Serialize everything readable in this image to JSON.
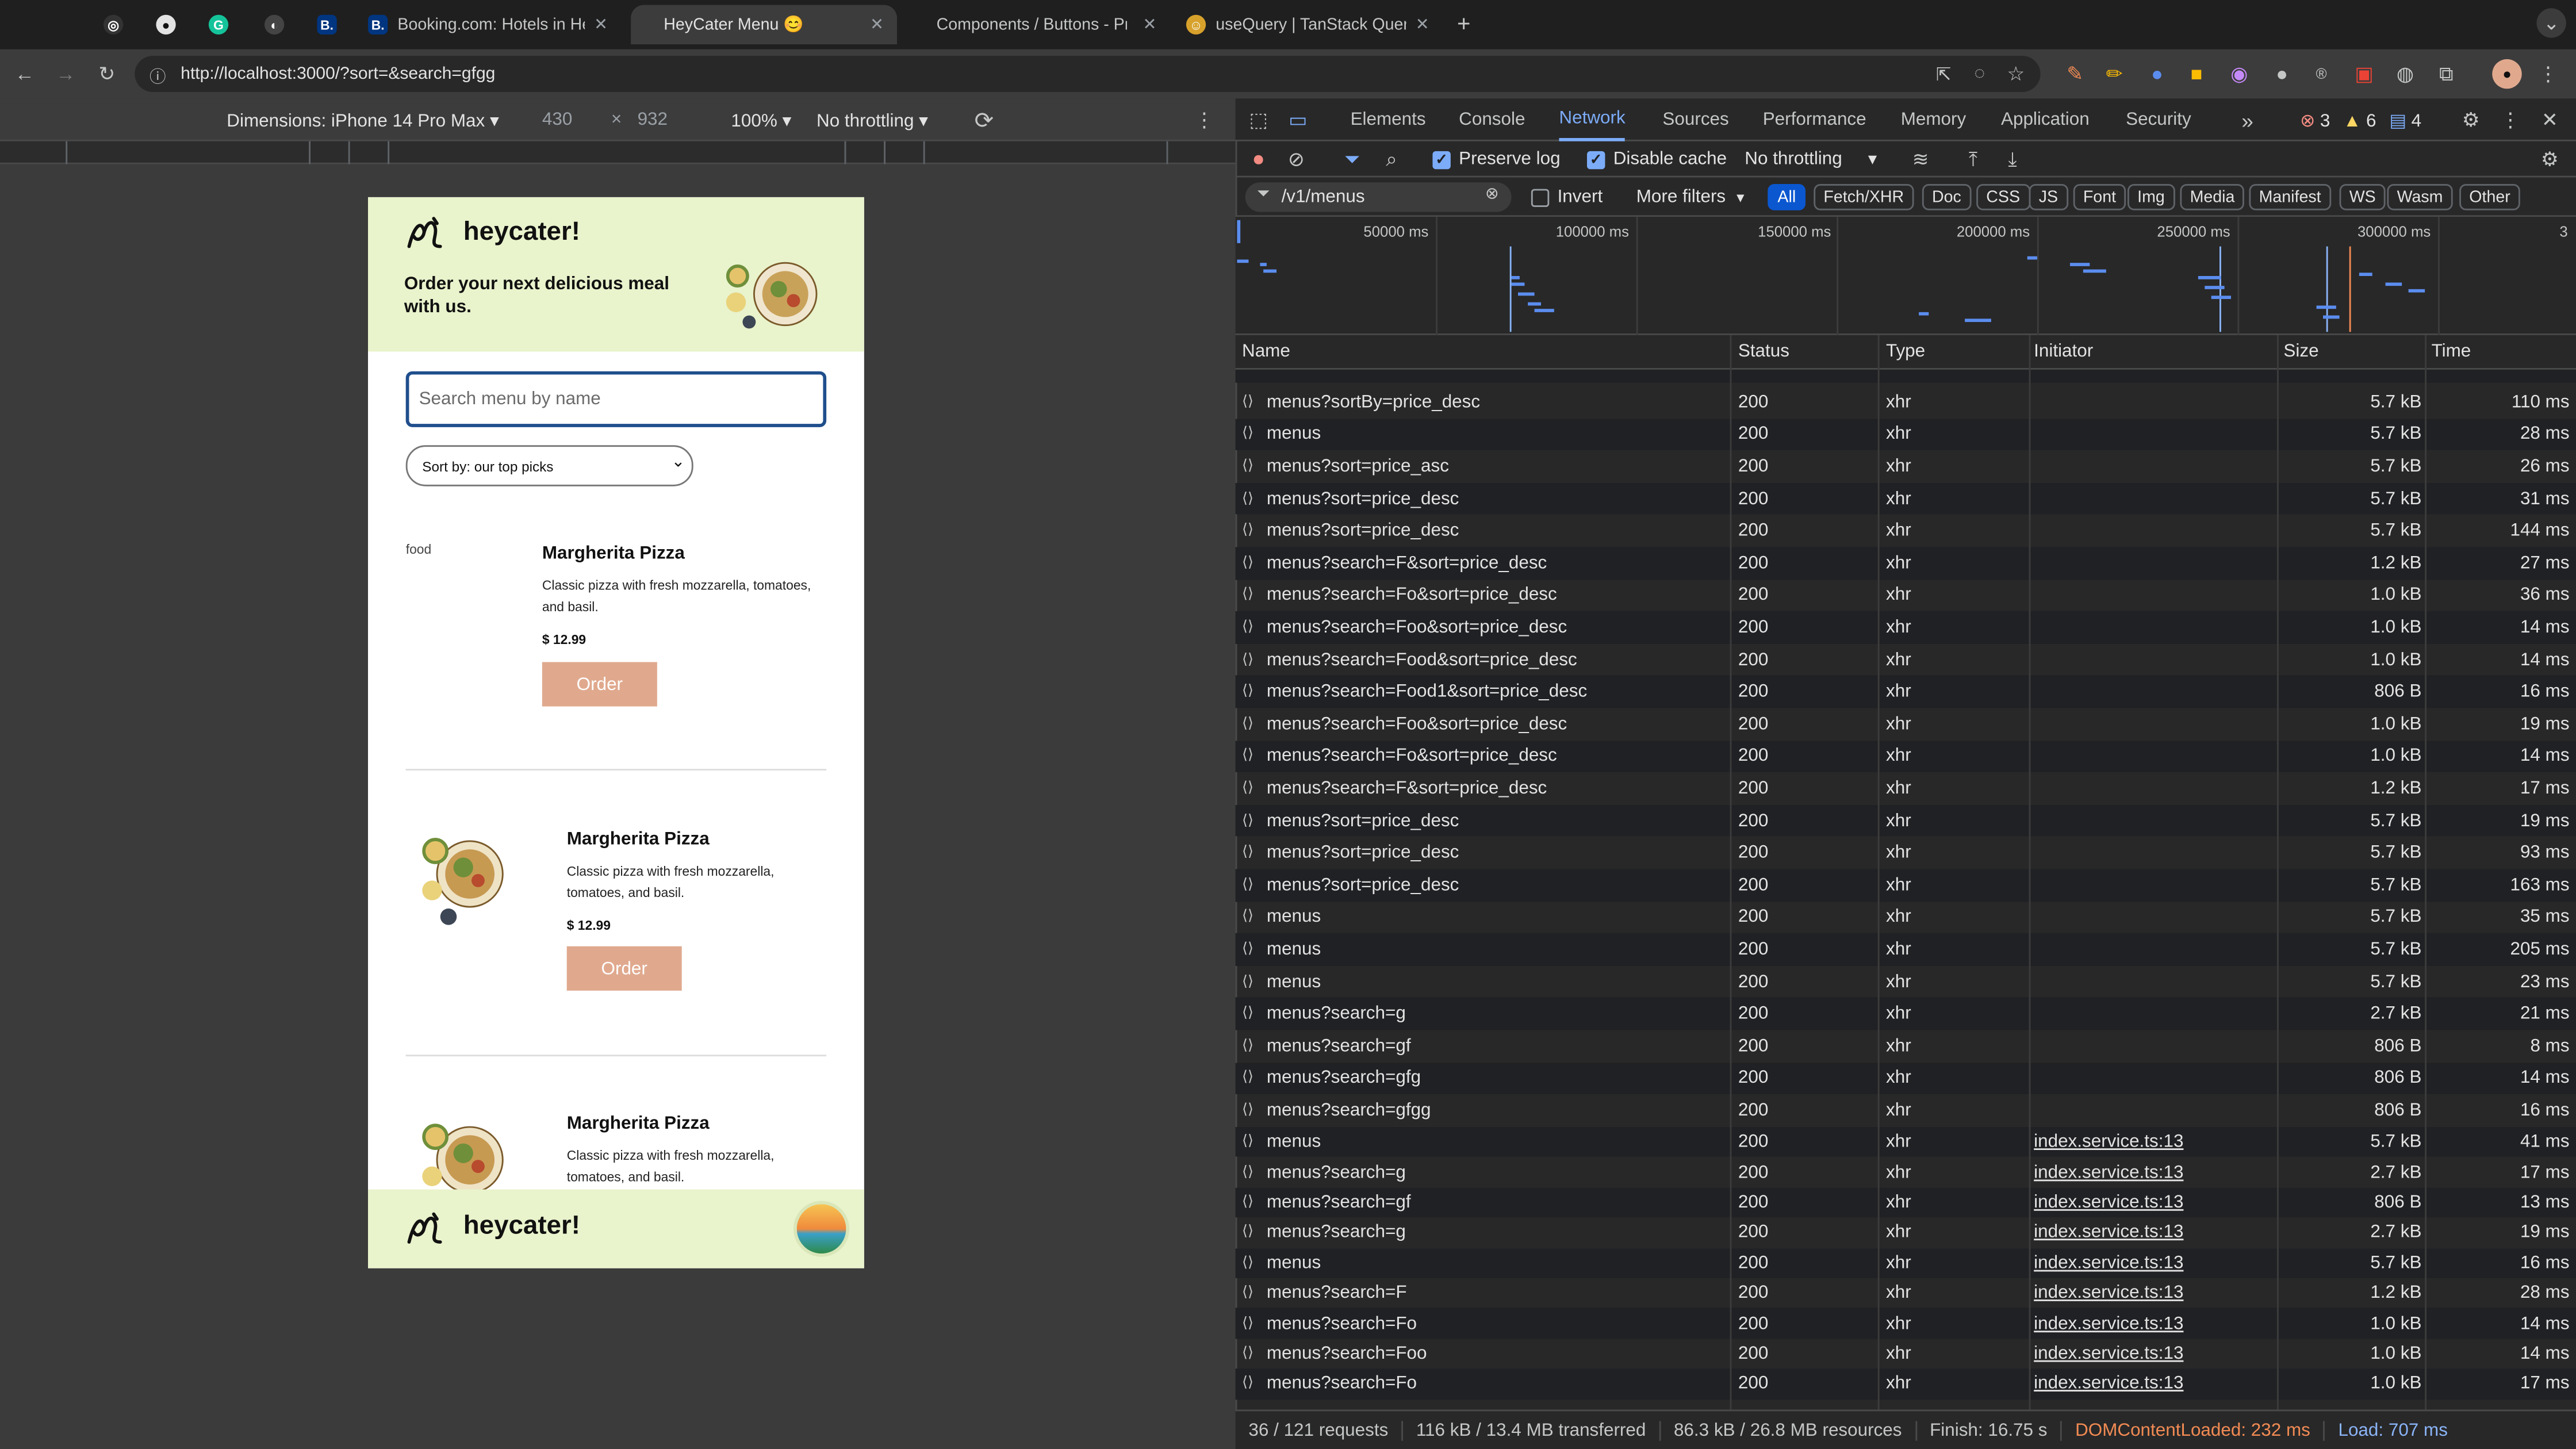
{
  "browser": {
    "tabs": [
      {
        "title": "",
        "icon": "fav-dark-icon"
      },
      {
        "title": "",
        "icon": "github-icon"
      },
      {
        "title": "",
        "icon": "grammarly-icon"
      },
      {
        "title": "",
        "icon": "dev-icon"
      },
      {
        "title": "",
        "icon": "booking-icon"
      },
      {
        "title": "Booking.com: Hotels in Helsi",
        "icon": "booking-icon"
      },
      {
        "title": "HeyCater Menu 😊",
        "icon": "heycater-icon"
      },
      {
        "title": "Components / Buttons - Prim",
        "icon": "storybook-icon"
      },
      {
        "title": "useQuery | TanStack Query R",
        "icon": "tanstack-icon"
      }
    ],
    "url": "http://localhost:3000/?sort=&search=gfgg"
  },
  "device_toolbar": {
    "dimensions": "Dimensions: iPhone 14 Pro Max ▾",
    "width": "430",
    "times": "×",
    "height": "932",
    "zoom": "100% ▾",
    "throttle": "No throttling ▾"
  },
  "app": {
    "brand": "heycater!",
    "tagline": "Order your next delicious meal with us.",
    "search_placeholder": "Search menu by name",
    "sort_label": "Sort by: our top picks",
    "broken_image_alt": "food",
    "items": [
      {
        "title": "Margherita Pizza",
        "desc": "Classic pizza with fresh mozzarella, tomatoes, and basil.",
        "price": "$ 12.99",
        "order": "Order"
      },
      {
        "title": "Margherita Pizza",
        "desc": "Classic pizza with fresh mozzarella, tomatoes, and basil.",
        "price": "$ 12.99",
        "order": "Order"
      },
      {
        "title": "Margherita Pizza",
        "desc": "Classic pizza with fresh mozzarella, tomatoes, and basil.",
        "price": "",
        "order": ""
      }
    ],
    "footer_brand": "heycater!"
  },
  "devtools": {
    "tabs": [
      "Elements",
      "Console",
      "Network",
      "Sources",
      "Performance",
      "Memory",
      "Application",
      "Security"
    ],
    "selected_tab": "Network",
    "errors": "3",
    "warnings": "6",
    "messages": "4",
    "preserve_log": "Preserve log",
    "disable_cache": "Disable cache",
    "throttling": "No throttling",
    "filter_value": "/v1/menus",
    "invert": "Invert",
    "more_filters": "More filters",
    "type_filters": [
      "All",
      "Fetch/XHR",
      "Doc",
      "CSS",
      "JS",
      "Font",
      "Img",
      "Media",
      "Manifest",
      "WS",
      "Wasm",
      "Other"
    ],
    "overview_labels": [
      "50000 ms",
      "100000 ms",
      "150000 ms",
      "200000 ms",
      "250000 ms",
      "300000 ms",
      "3"
    ],
    "columns": [
      "Name",
      "Status",
      "Type",
      "Initiator",
      "Size",
      "Time"
    ],
    "requests": [
      {
        "name": "menus?sortBy=price_desc",
        "status": "200",
        "type": "xhr",
        "initiator": "",
        "size": "5.7 kB",
        "time": "110 ms"
      },
      {
        "name": "menus",
        "status": "200",
        "type": "xhr",
        "initiator": "",
        "size": "5.7 kB",
        "time": "28 ms"
      },
      {
        "name": "menus?sort=price_asc",
        "status": "200",
        "type": "xhr",
        "initiator": "",
        "size": "5.7 kB",
        "time": "26 ms"
      },
      {
        "name": "menus?sort=price_desc",
        "status": "200",
        "type": "xhr",
        "initiator": "",
        "size": "5.7 kB",
        "time": "31 ms"
      },
      {
        "name": "menus?sort=price_desc",
        "status": "200",
        "type": "xhr",
        "initiator": "",
        "size": "5.7 kB",
        "time": "144 ms"
      },
      {
        "name": "menus?search=F&sort=price_desc",
        "status": "200",
        "type": "xhr",
        "initiator": "",
        "size": "1.2 kB",
        "time": "27 ms"
      },
      {
        "name": "menus?search=Fo&sort=price_desc",
        "status": "200",
        "type": "xhr",
        "initiator": "",
        "size": "1.0 kB",
        "time": "36 ms"
      },
      {
        "name": "menus?search=Foo&sort=price_desc",
        "status": "200",
        "type": "xhr",
        "initiator": "",
        "size": "1.0 kB",
        "time": "14 ms"
      },
      {
        "name": "menus?search=Food&sort=price_desc",
        "status": "200",
        "type": "xhr",
        "initiator": "",
        "size": "1.0 kB",
        "time": "14 ms"
      },
      {
        "name": "menus?search=Food1&sort=price_desc",
        "status": "200",
        "type": "xhr",
        "initiator": "",
        "size": "806 B",
        "time": "16 ms"
      },
      {
        "name": "menus?search=Foo&sort=price_desc",
        "status": "200",
        "type": "xhr",
        "initiator": "",
        "size": "1.0 kB",
        "time": "19 ms"
      },
      {
        "name": "menus?search=Fo&sort=price_desc",
        "status": "200",
        "type": "xhr",
        "initiator": "",
        "size": "1.0 kB",
        "time": "14 ms"
      },
      {
        "name": "menus?search=F&sort=price_desc",
        "status": "200",
        "type": "xhr",
        "initiator": "",
        "size": "1.2 kB",
        "time": "17 ms"
      },
      {
        "name": "menus?sort=price_desc",
        "status": "200",
        "type": "xhr",
        "initiator": "",
        "size": "5.7 kB",
        "time": "19 ms"
      },
      {
        "name": "menus?sort=price_desc",
        "status": "200",
        "type": "xhr",
        "initiator": "",
        "size": "5.7 kB",
        "time": "93 ms"
      },
      {
        "name": "menus?sort=price_desc",
        "status": "200",
        "type": "xhr",
        "initiator": "",
        "size": "5.7 kB",
        "time": "163 ms"
      },
      {
        "name": "menus",
        "status": "200",
        "type": "xhr",
        "initiator": "",
        "size": "5.7 kB",
        "time": "35 ms"
      },
      {
        "name": "menus",
        "status": "200",
        "type": "xhr",
        "initiator": "",
        "size": "5.7 kB",
        "time": "205 ms"
      },
      {
        "name": "menus",
        "status": "200",
        "type": "xhr",
        "initiator": "",
        "size": "5.7 kB",
        "time": "23 ms"
      },
      {
        "name": "menus?search=g",
        "status": "200",
        "type": "xhr",
        "initiator": "",
        "size": "2.7 kB",
        "time": "21 ms"
      },
      {
        "name": "menus?search=gf",
        "status": "200",
        "type": "xhr",
        "initiator": "",
        "size": "806 B",
        "time": "8 ms"
      },
      {
        "name": "menus?search=gfg",
        "status": "200",
        "type": "xhr",
        "initiator": "",
        "size": "806 B",
        "time": "14 ms"
      },
      {
        "name": "menus?search=gfgg",
        "status": "200",
        "type": "xhr",
        "initiator": "",
        "size": "806 B",
        "time": "16 ms"
      },
      {
        "name": "menus",
        "status": "200",
        "type": "xhr",
        "initiator": "index.service.ts:13",
        "size": "5.7 kB",
        "time": "41 ms"
      },
      {
        "name": "menus?search=g",
        "status": "200",
        "type": "xhr",
        "initiator": "index.service.ts:13",
        "size": "2.7 kB",
        "time": "17 ms"
      },
      {
        "name": "menus?search=gf",
        "status": "200",
        "type": "xhr",
        "initiator": "index.service.ts:13",
        "size": "806 B",
        "time": "13 ms"
      },
      {
        "name": "menus?search=g",
        "status": "200",
        "type": "xhr",
        "initiator": "index.service.ts:13",
        "size": "2.7 kB",
        "time": "19 ms"
      },
      {
        "name": "menus",
        "status": "200",
        "type": "xhr",
        "initiator": "index.service.ts:13",
        "size": "5.7 kB",
        "time": "16 ms"
      },
      {
        "name": "menus?search=F",
        "status": "200",
        "type": "xhr",
        "initiator": "index.service.ts:13",
        "size": "1.2 kB",
        "time": "28 ms"
      },
      {
        "name": "menus?search=Fo",
        "status": "200",
        "type": "xhr",
        "initiator": "index.service.ts:13",
        "size": "1.0 kB",
        "time": "14 ms"
      },
      {
        "name": "menus?search=Foo",
        "status": "200",
        "type": "xhr",
        "initiator": "index.service.ts:13",
        "size": "1.0 kB",
        "time": "14 ms"
      },
      {
        "name": "menus?search=Fo",
        "status": "200",
        "type": "xhr",
        "initiator": "index.service.ts:13",
        "size": "1.0 kB",
        "time": "17 ms"
      }
    ],
    "summary": {
      "requests": "36 / 121 requests",
      "transferred": "116 kB / 13.4 MB transferred",
      "resources": "86.3 kB / 26.8 MB resources",
      "finish": "Finish: 16.75 s",
      "dcl": "DOMContentLoaded: 232 ms",
      "load": "Load: 707 ms"
    },
    "colors": {
      "accent": "#7cacf8",
      "dcl": "#f28b54",
      "load": "#8ab4f8",
      "error": "#f28b82",
      "warning": "#fdd663"
    }
  }
}
